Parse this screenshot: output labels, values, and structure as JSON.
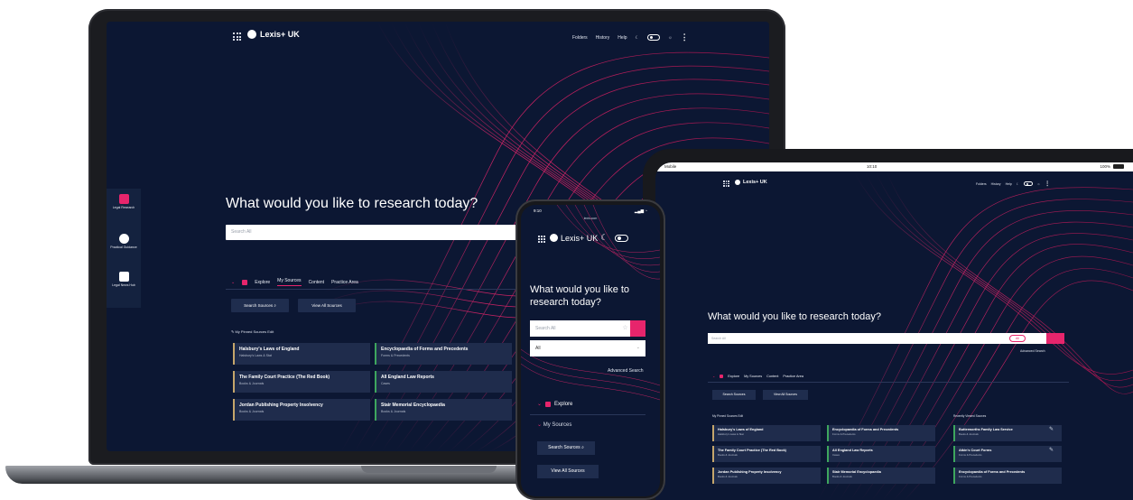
{
  "laptop": {
    "brand": "Lexis+ UK",
    "nav": [
      "Folders",
      "History",
      "Help"
    ],
    "heading": "What would you like to research today?",
    "search_placeholder": "Search All",
    "sidebar": [
      {
        "label": "Legal Research"
      },
      {
        "label": "Practical Guidance"
      },
      {
        "label": "Legal News Hub"
      }
    ],
    "tabs": [
      "Explore",
      "My Sources",
      "Content",
      "Practice Area"
    ],
    "search_sources_label": "Search Sources",
    "view_all_label": "View All Sources",
    "pinned_label": "My Pinned Sources",
    "pinned_edit": "Edit",
    "cards": [
      {
        "title": "Halsbury's Laws of England",
        "sub": "Halsbury's Laws & Stat"
      },
      {
        "title": "Encyclopaedia of Forms and Precedents",
        "sub": "Forms & Precedents"
      },
      {
        "title": "The Family Court Practice (The Red Book)",
        "sub": "Books & Journals"
      },
      {
        "title": "All England Law Reports",
        "sub": "Cases"
      },
      {
        "title": "Jordan Publishing Property Insolvency",
        "sub": "Books & Journals"
      },
      {
        "title": "Stair Memorial Encyclopaedia",
        "sub": "Books & Journals"
      }
    ]
  },
  "tablet": {
    "status_left": "Mobile",
    "status_time": "10:10",
    "status_battery": "100%",
    "brand": "Lexis+ UK",
    "nav": [
      "Folders",
      "History",
      "Help"
    ],
    "heading": "What would you like to research today?",
    "search_placeholder": "Search All",
    "all_label": "All",
    "advanced_search": "Advanced Search",
    "tabs": [
      "Explore",
      "My Sources",
      "Content",
      "Practice Area"
    ],
    "search_sources_label": "Search Sources",
    "view_all_label": "View All Sources",
    "pinned_label": "My Pinned Sources",
    "pinned_edit": "Edit",
    "recent_label": "Recently Viewed Sources",
    "cards": [
      {
        "title": "Halsbury's Laws of England",
        "sub": "Halsbury's Laws & Stat"
      },
      {
        "title": "Encyclopaedia of Forms and Precedents",
        "sub": "Forms & Precedents"
      },
      {
        "title": "The Family Court Practice (The Red Book)",
        "sub": "Books & Journals"
      },
      {
        "title": "All England Law Reports",
        "sub": "Cases"
      },
      {
        "title": "Jordan Publishing Property Insolvency",
        "sub": "Books & Journals"
      },
      {
        "title": "Stair Memorial Encyclopaedia",
        "sub": "Books & Journals"
      }
    ],
    "recent": [
      {
        "title": "Butterworths Family Law Service",
        "sub": "Books & Journals"
      },
      {
        "title": "Atkin's Court Forms",
        "sub": "Forms & Precedents"
      },
      {
        "title": "Encyclopaedia of Forms and Precedents",
        "sub": "Forms & Precedents"
      }
    ]
  },
  "phone": {
    "status_time": "9:10",
    "url": "lexis.com",
    "brand": "Lexis+ UK",
    "heading": "What would you like to research today?",
    "search_placeholder": "Search All",
    "select_value": "All",
    "advanced_search": "Advanced Search",
    "explore": "Explore",
    "my_sources": "My Sources",
    "search_sources_label": "Search Sources",
    "view_all_label": "View All Sources"
  },
  "colors": {
    "background": "#0c1733",
    "accent": "#e7256c",
    "card": "#1f2c4c"
  }
}
